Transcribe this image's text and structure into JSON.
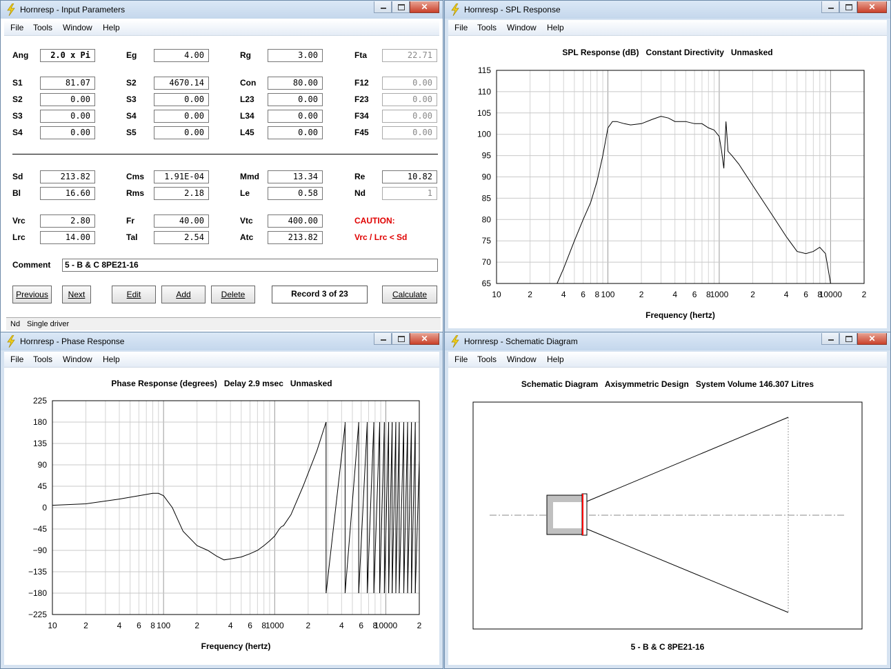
{
  "colors": {
    "caution": "#e00000",
    "schematic_gray": "#c0c0c0",
    "schematic_red": "#ff0000"
  },
  "windows": {
    "input": {
      "title": "Hornresp - Input Parameters",
      "icon": "lightning-icon"
    },
    "spl": {
      "title": "Hornresp - SPL Response",
      "icon": "lightning-icon"
    },
    "phase": {
      "title": "Hornresp - Phase Response",
      "icon": "lightning-icon"
    },
    "schematic": {
      "title": "Hornresp - Schematic Diagram",
      "icon": "lightning-icon"
    }
  },
  "menu": {
    "file": "File",
    "tools": "Tools",
    "window": "Window",
    "help": "Help"
  },
  "params": {
    "Ang": {
      "label": "Ang",
      "value": "2.0 x Pi"
    },
    "Eg": {
      "label": "Eg",
      "value": "4.00"
    },
    "Rg": {
      "label": "Rg",
      "value": "3.00"
    },
    "Fta": {
      "label": "Fta",
      "value": "22.71"
    },
    "S1": {
      "label": "S1",
      "value": "81.07"
    },
    "S2b": {
      "label": "S2",
      "value": "4670.14"
    },
    "Con": {
      "label": "Con",
      "value": "80.00"
    },
    "F12": {
      "label": "F12",
      "value": "0.00"
    },
    "S2": {
      "label": "S2",
      "value": "0.00"
    },
    "S3b": {
      "label": "S3",
      "value": "0.00"
    },
    "L23": {
      "label": "L23",
      "value": "0.00"
    },
    "F23": {
      "label": "F23",
      "value": "0.00"
    },
    "S3": {
      "label": "S3",
      "value": "0.00"
    },
    "S4b": {
      "label": "S4",
      "value": "0.00"
    },
    "L34": {
      "label": "L34",
      "value": "0.00"
    },
    "F34": {
      "label": "F34",
      "value": "0.00"
    },
    "S4": {
      "label": "S4",
      "value": "0.00"
    },
    "S5": {
      "label": "S5",
      "value": "0.00"
    },
    "L45": {
      "label": "L45",
      "value": "0.00"
    },
    "F45": {
      "label": "F45",
      "value": "0.00"
    },
    "Sd": {
      "label": "Sd",
      "value": "213.82"
    },
    "Cms": {
      "label": "Cms",
      "value": "1.91E-04"
    },
    "Mmd": {
      "label": "Mmd",
      "value": "13.34"
    },
    "Re": {
      "label": "Re",
      "value": "10.82"
    },
    "Bl": {
      "label": "Bl",
      "value": "16.60"
    },
    "Rms": {
      "label": "Rms",
      "value": "2.18"
    },
    "Le": {
      "label": "Le",
      "value": "0.58"
    },
    "Nd": {
      "label": "Nd",
      "value": "1"
    },
    "Vrc": {
      "label": "Vrc",
      "value": "2.80"
    },
    "Fr": {
      "label": "Fr",
      "value": "40.00"
    },
    "Vtc": {
      "label": "Vtc",
      "value": "400.00"
    },
    "Lrc": {
      "label": "Lrc",
      "value": "14.00"
    },
    "Tal": {
      "label": "Tal",
      "value": "2.54"
    },
    "Atc": {
      "label": "Atc",
      "value": "213.82"
    }
  },
  "caution": {
    "title": "CAUTION:",
    "message": "Vrc / Lrc < Sd"
  },
  "comment": {
    "label": "Comment",
    "value": "5 - B & C 8PE21-16"
  },
  "buttons": {
    "previous": "Previous",
    "next": "Next",
    "edit": "Edit",
    "add": "Add",
    "delete": "Delete",
    "calculate": "Calculate"
  },
  "record": "Record 3 of 23",
  "status": {
    "key": "Nd",
    "text": "Single driver"
  },
  "spl_chart": {
    "title": "SPL Response (dB)   Constant Directivity   Unmasked"
  },
  "phase_chart": {
    "title": "Phase Response (degrees)   Delay 2.9 msec   Unmasked"
  },
  "schematic": {
    "title": "Schematic Diagram   Axisymmetric Design   System Volume 146.307 Litres",
    "caption": "5 - B & C 8PE21-16"
  },
  "chart_data": [
    {
      "type": "line",
      "title": "SPL Response (dB)   Constant Directivity   Unmasked",
      "xlabel": "Frequency (hertz)",
      "ylabel": "",
      "x_scale": "log",
      "xlim": [
        10,
        20000
      ],
      "ylim": [
        65,
        115
      ],
      "grid": true,
      "yticks": [
        115,
        110,
        105,
        100,
        95,
        90,
        85,
        80,
        75,
        70,
        65
      ],
      "xtick_labels": [
        "10",
        "2",
        "4",
        "6",
        "8",
        "100",
        "2",
        "4",
        "6",
        "8",
        "1000",
        "2",
        "4",
        "6",
        "8",
        "10000",
        "2"
      ],
      "series": [
        {
          "x": [
            35,
            40,
            50,
            60,
            70,
            80,
            90,
            100,
            110,
            120,
            140,
            160,
            200,
            250,
            300,
            350,
            400,
            500,
            600,
            700,
            800,
            900,
            1000,
            1050,
            1100,
            1150,
            1200,
            1300,
            1500,
            2000,
            3000,
            4000,
            5000,
            6000,
            7000,
            8000,
            9000,
            10000
          ],
          "y": [
            65,
            68.5,
            75,
            80,
            84,
            89,
            95,
            101.5,
            103,
            103,
            102.5,
            102.2,
            102.5,
            103.5,
            104.2,
            103.8,
            103,
            103,
            102.5,
            102.5,
            101.5,
            101,
            99.5,
            96,
            92,
            103,
            96,
            95,
            93,
            88,
            81,
            76,
            72.5,
            72,
            72.5,
            73.5,
            72,
            65
          ]
        }
      ]
    },
    {
      "type": "line",
      "title": "Phase Response (degrees)   Delay 2.9 msec   Unmasked",
      "xlabel": "Frequency (hertz)",
      "ylabel": "",
      "x_scale": "log",
      "xlim": [
        10,
        20000
      ],
      "ylim": [
        -225,
        225
      ],
      "grid": true,
      "yticks": [
        225,
        180,
        135,
        90,
        45,
        0,
        -45,
        -90,
        -135,
        -180,
        -225
      ],
      "xtick_labels": [
        "10",
        "2",
        "4",
        "6",
        "8",
        "100",
        "2",
        "4",
        "6",
        "8",
        "1000",
        "2",
        "4",
        "6",
        "8",
        "10000",
        "2"
      ],
      "series": [
        {
          "x": [
            10,
            20,
            40,
            60,
            80,
            90,
            100,
            120,
            150,
            200,
            250,
            300,
            350,
            400,
            500,
            600,
            700,
            800,
            900,
            1000,
            1100,
            1150,
            1200,
            1400,
            1800,
            2400,
            2900
          ],
          "y": [
            5,
            8,
            18,
            25,
            30,
            30,
            25,
            0,
            -50,
            -80,
            -90,
            -102,
            -110,
            -108,
            -104,
            -97,
            -90,
            -80,
            -70,
            -60,
            -45,
            -40,
            -38,
            -15,
            45,
            120,
            180
          ]
        }
      ]
    }
  ]
}
